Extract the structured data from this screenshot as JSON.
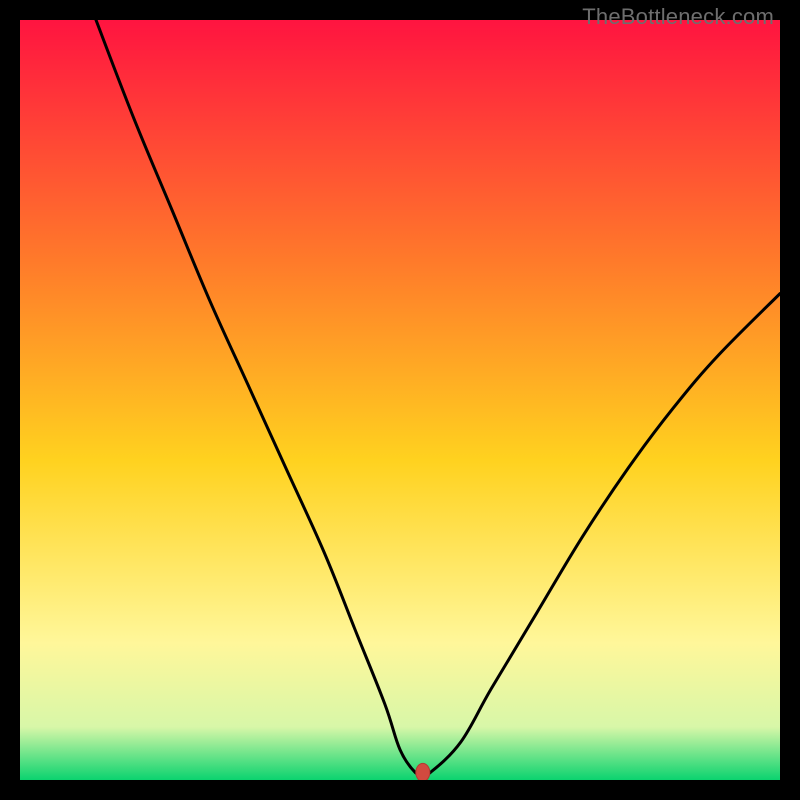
{
  "watermark": "TheBottleneck.com",
  "colors": {
    "frame": "#000000",
    "gradient_top": "#ff1440",
    "gradient_mid_upper": "#ff7b2a",
    "gradient_mid": "#ffd21f",
    "gradient_lower": "#fff79a",
    "gradient_bottom": "#0bd36f",
    "curve": "#000000",
    "marker_fill": "#d24a3f",
    "marker_stroke": "#b33b33"
  },
  "chart_data": {
    "type": "line",
    "title": "",
    "xlabel": "",
    "ylabel": "",
    "xlim": [
      0,
      100
    ],
    "ylim": [
      0,
      100
    ],
    "series": [
      {
        "name": "bottleneck-curve",
        "x": [
          10,
          15,
          20,
          25,
          30,
          35,
          40,
          44,
          48,
          50,
          52,
          53,
          54,
          58,
          62,
          68,
          74,
          80,
          86,
          92,
          100
        ],
        "y": [
          100,
          87,
          75,
          63,
          52,
          41,
          30,
          20,
          10,
          4,
          1,
          1,
          1,
          5,
          12,
          22,
          32,
          41,
          49,
          56,
          64
        ]
      }
    ],
    "flat_segment": {
      "x_from": 50,
      "x_to": 54,
      "y": 1
    },
    "marker": {
      "x": 53,
      "y": 1
    }
  }
}
